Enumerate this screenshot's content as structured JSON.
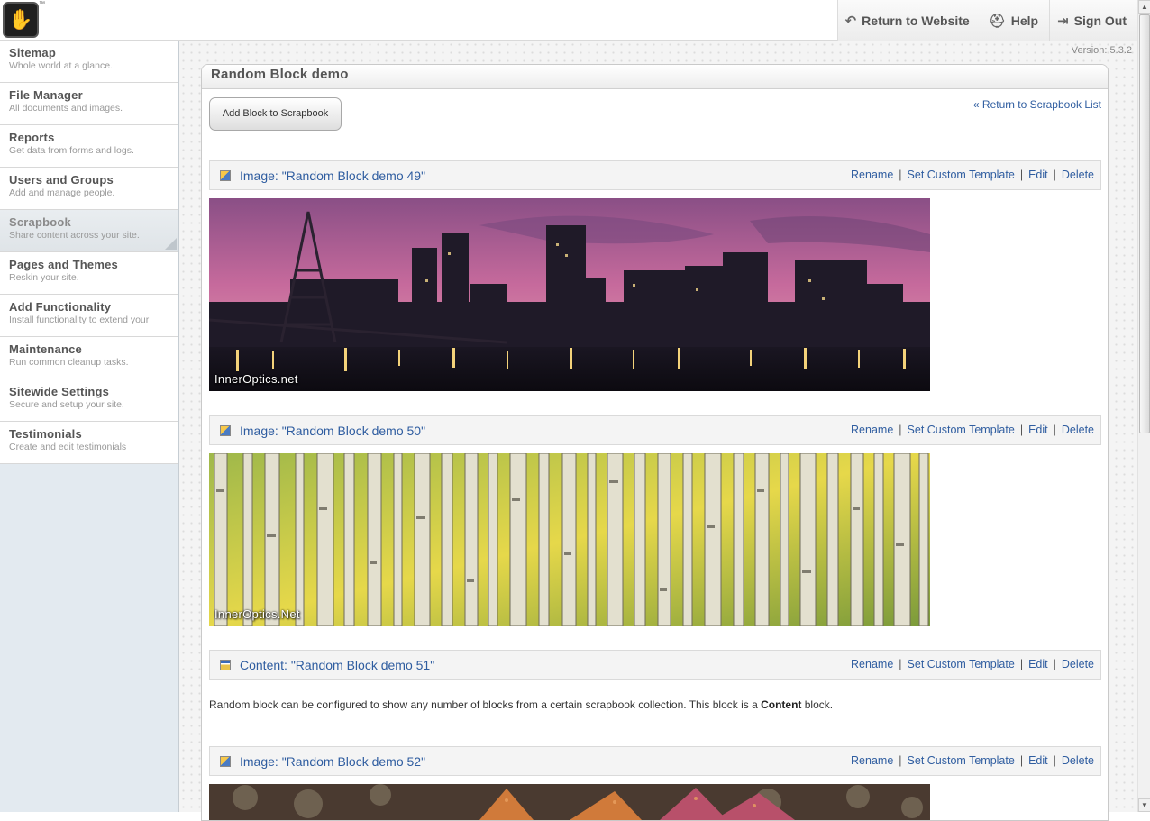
{
  "topnav": {
    "items": [
      {
        "label": "Return to Website",
        "icon": "return-arrow-icon"
      },
      {
        "label": "Help",
        "icon": "help-icon"
      },
      {
        "label": "Sign Out",
        "icon": "sign-out-icon"
      }
    ]
  },
  "sidebar": {
    "items": [
      {
        "title": "Sitemap",
        "desc": "Whole world at a glance."
      },
      {
        "title": "File Manager",
        "desc": "All documents and images."
      },
      {
        "title": "Reports",
        "desc": "Get data from forms and logs."
      },
      {
        "title": "Users and Groups",
        "desc": "Add and manage people."
      },
      {
        "title": "Scrapbook",
        "desc": "Share content across your site."
      },
      {
        "title": "Pages and Themes",
        "desc": "Reskin your site."
      },
      {
        "title": "Add Functionality",
        "desc": "Install functionality to extend your"
      },
      {
        "title": "Maintenance",
        "desc": "Run common cleanup tasks."
      },
      {
        "title": "Sitewide Settings",
        "desc": "Secure and setup your site."
      },
      {
        "title": "Testimonials",
        "desc": "Create and edit testimonials"
      }
    ],
    "active_index": 4
  },
  "version": "Version: 5.3.2",
  "panel": {
    "title": "Random Block demo",
    "add_button": "Add Block to Scrapbook",
    "return_link": "« Return to Scrapbook List"
  },
  "actions": {
    "rename": "Rename",
    "template": "Set Custom Template",
    "edit": "Edit",
    "delete": "Delete"
  },
  "blocks": [
    {
      "title": "Image: \"Random Block demo 49\"",
      "type": "image",
      "caption": "InnerOptics.net"
    },
    {
      "title": "Image: \"Random Block demo 50\"",
      "type": "image",
      "caption": "InnerOptics.Net"
    },
    {
      "title": "Content: \"Random Block demo 51\"",
      "type": "content"
    },
    {
      "title": "Image: \"Random Block demo 52\"",
      "type": "image"
    }
  ],
  "content_text": {
    "before": "Random block can be configured to show any number of blocks from a certain scrapbook collection. This block is a ",
    "bold": "Content",
    "after": " block."
  }
}
